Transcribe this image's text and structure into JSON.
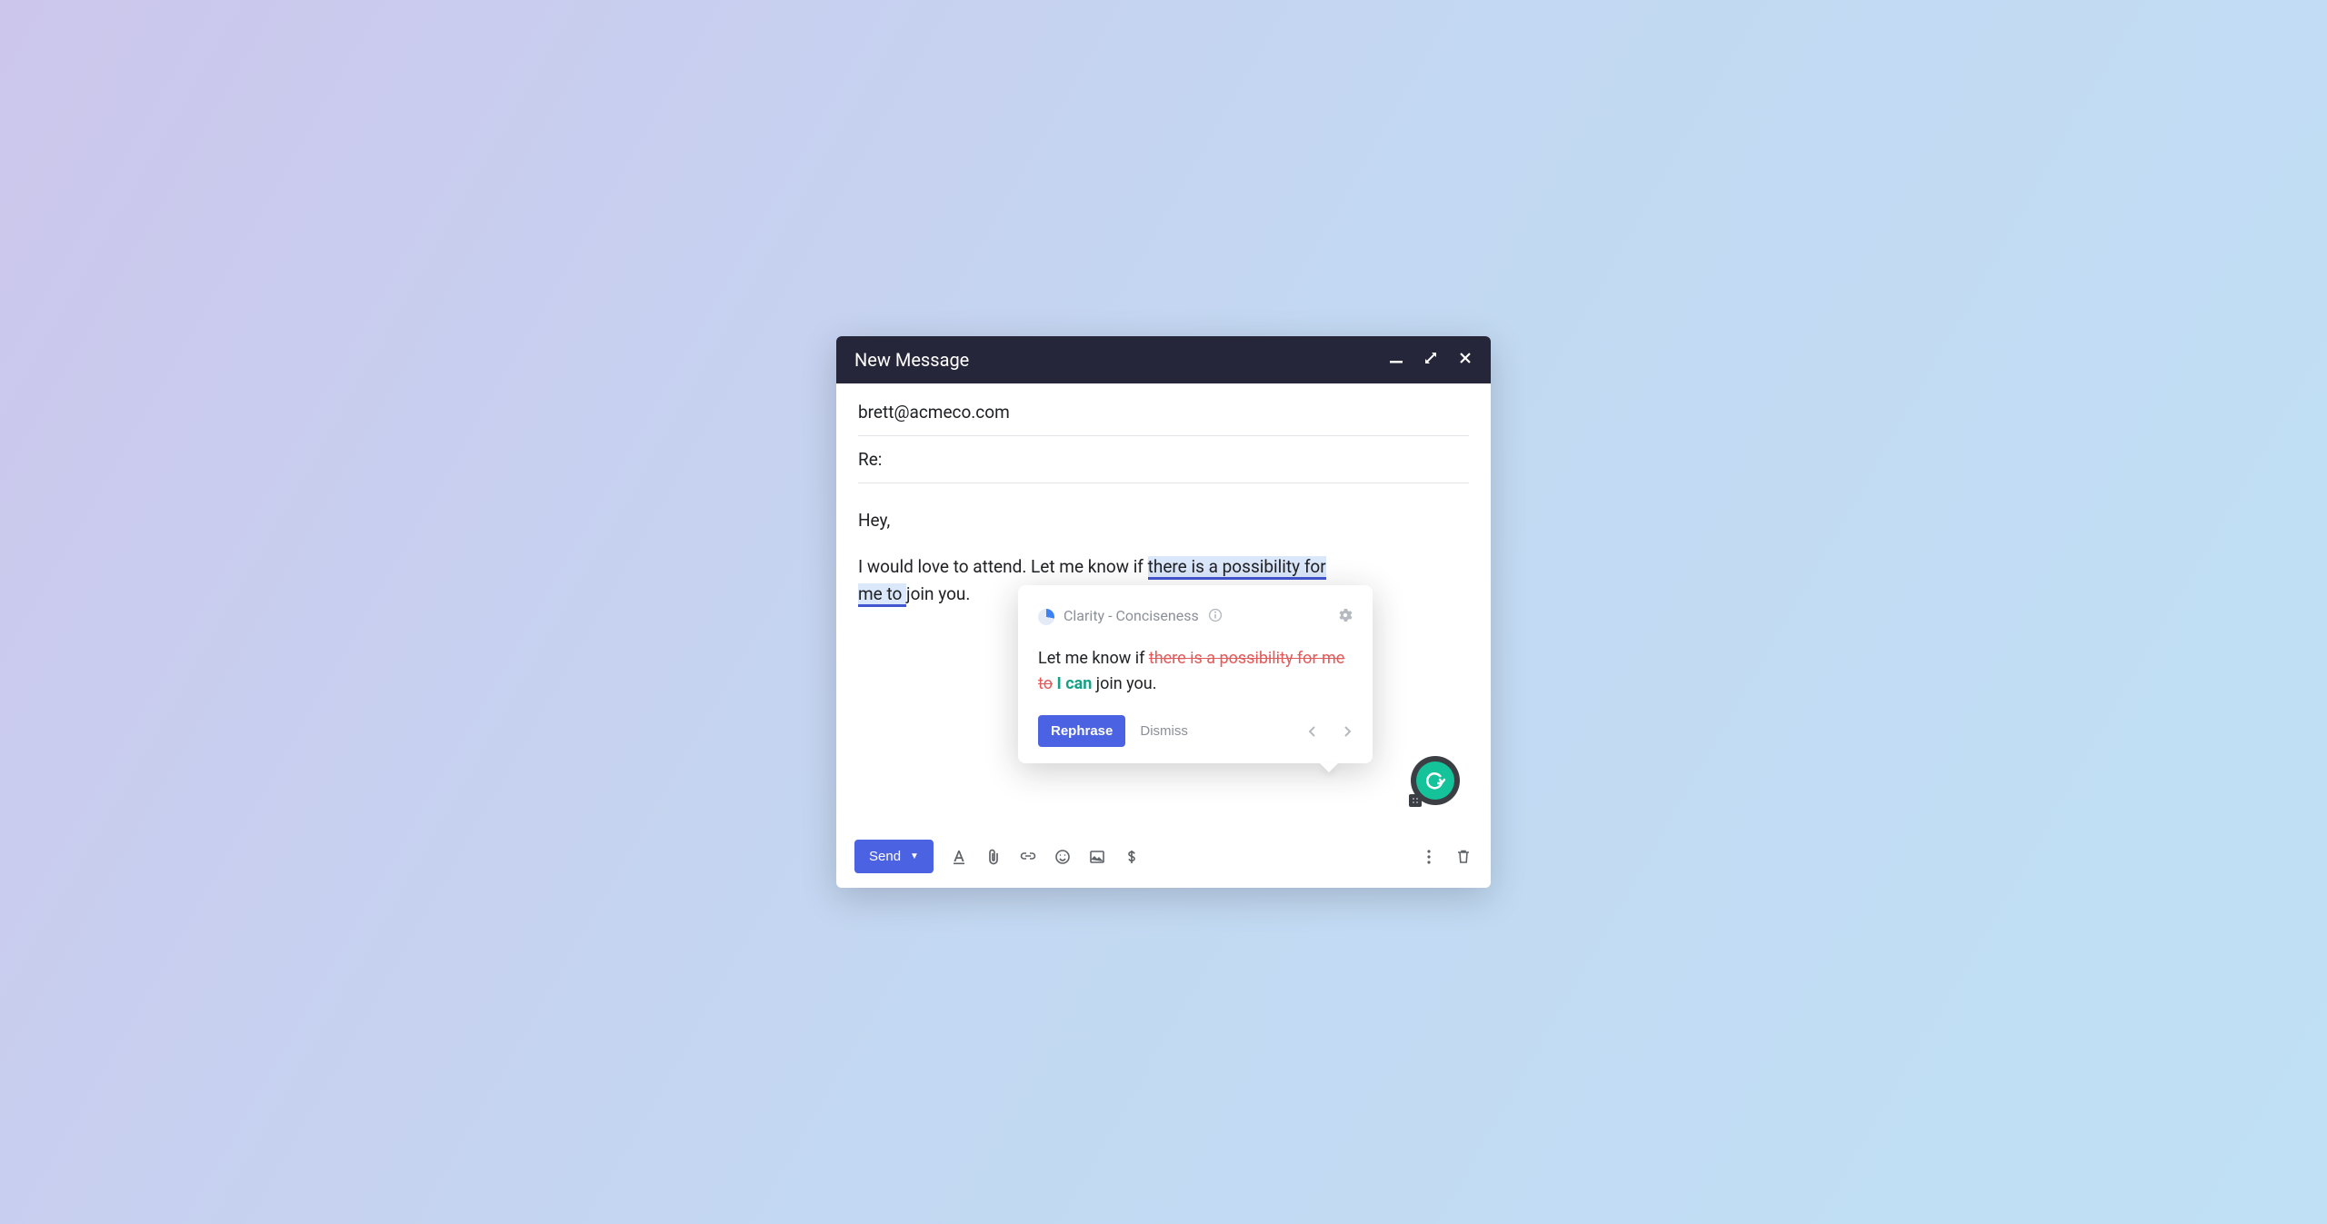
{
  "compose": {
    "title": "New Message",
    "to": "brett@acmeco.com",
    "subject": "Re:",
    "body": {
      "greeting": "Hey,",
      "line_prefix": "I would love to attend. Let me know if ",
      "highlight_1": "there is a possibility for ",
      "highlight_2": "me to ",
      "line_suffix": "join you."
    }
  },
  "suggestion": {
    "category": "Clarity - Conciseness",
    "text_prefix": "Let me know if ",
    "text_strike": "there is a possibility for me to",
    "text_insert": " I can ",
    "text_suffix": "join you.",
    "rephrase_label": "Rephrase",
    "dismiss_label": "Dismiss"
  },
  "toolbar": {
    "send_label": "Send"
  },
  "icons": {
    "minimize": "minimize-icon",
    "expand": "expand-icon",
    "close": "close-icon",
    "info": "info-icon",
    "gear": "gear-icon",
    "prev": "chevron-left-icon",
    "next": "chevron-right-icon",
    "grammarly": "grammarly-icon",
    "format": "text-format-icon",
    "attach": "paperclip-icon",
    "link": "link-icon",
    "emoji": "emoji-icon",
    "image": "image-icon",
    "money": "dollar-icon",
    "more": "more-vert-icon",
    "trash": "trash-icon"
  },
  "colors": {
    "accent": "#4b62e3",
    "titlebar": "#25263a",
    "strike": "#e25a5a",
    "insert": "#16a085",
    "grammarly": "#15c39a"
  }
}
